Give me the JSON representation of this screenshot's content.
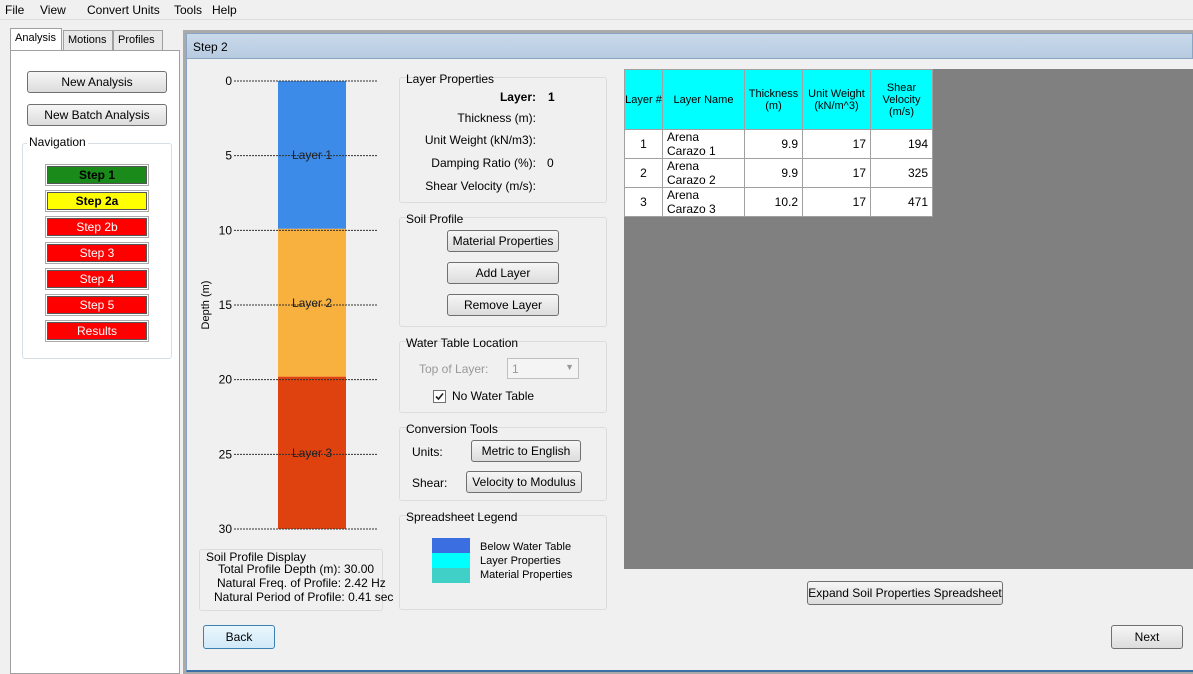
{
  "menu": [
    "File",
    "View",
    "Convert Units",
    "Tools",
    "Help"
  ],
  "tabs": [
    "Analysis",
    "Motions",
    "Profiles"
  ],
  "left": {
    "new_analysis": "New Analysis",
    "new_batch": "New Batch Analysis",
    "navigation_label": "Navigation",
    "steps": [
      {
        "label": "Step 1",
        "color": "#1a8a1a",
        "text_color": "#000000"
      },
      {
        "label": "Step 2a",
        "color": "#ffff00",
        "text_color": "#000000"
      },
      {
        "label": "Step 2b",
        "color": "#ff0000",
        "text_color": "#ffffff"
      },
      {
        "label": "Step 3",
        "color": "#ff0000",
        "text_color": "#ffffff"
      },
      {
        "label": "Step 4",
        "color": "#ff0000",
        "text_color": "#ffffff"
      },
      {
        "label": "Step 5",
        "color": "#ff0000",
        "text_color": "#ffffff"
      },
      {
        "label": "Results",
        "color": "#ff0000",
        "text_color": "#ffffff"
      }
    ]
  },
  "title": "Step 2",
  "profile": {
    "ylabel": "Depth (m)",
    "ticks": [
      "0",
      "5",
      "10",
      "15",
      "20",
      "25",
      "30"
    ],
    "layers": [
      {
        "label": "Layer 1",
        "from": 0,
        "to": 9.9,
        "color": "#3d8be8"
      },
      {
        "label": "Layer 2",
        "from": 9.9,
        "to": 19.8,
        "color": "#f8b13f"
      },
      {
        "label": "Layer 3",
        "from": 19.8,
        "to": 30,
        "color": "#e0420f"
      }
    ],
    "display_label": "Soil Profile Display",
    "total_depth": "Total Profile Depth (m): 30.00",
    "nat_freq": "Natural Freq. of Profile: 2.42 Hz",
    "nat_period": "Natural Period of Profile: 0.41 sec"
  },
  "layer_props": {
    "title": "Layer Properties",
    "layer_label": "Layer:",
    "layer_value": "1",
    "thickness": "Thickness (m):",
    "unit_weight": "Unit Weight (kN/m3):",
    "damping": "Damping Ratio (%):",
    "damping_value": "0",
    "shear": "Shear Velocity (m/s):"
  },
  "soil_profile": {
    "title": "Soil Profile",
    "material": "Material Properties",
    "add": "Add Layer",
    "remove": "Remove Layer"
  },
  "water": {
    "title": "Water Table Location",
    "top_label": "Top of Layer:",
    "top_value": "1",
    "no_water": "No Water Table"
  },
  "conversion": {
    "title": "Conversion Tools",
    "units_label": "Units:",
    "units_btn": "Metric to English",
    "shear_label": "Shear:",
    "shear_btn": "Velocity to Modulus"
  },
  "legend": {
    "title": "Spreadsheet Legend",
    "items": [
      {
        "label": "Below Water Table",
        "color": "#3b6ee0"
      },
      {
        "label": "Layer Properties",
        "color": "#00ffff"
      },
      {
        "label": "Material Properties",
        "color": "#40d0c8"
      }
    ]
  },
  "table": {
    "headers": [
      "Layer #",
      "Layer Name",
      "Thickness (m)",
      "Unit Weight (kN/m^3)",
      "Shear Velocity (m/s)"
    ],
    "rows": [
      [
        "1",
        "Arena Carazo 1",
        "9.9",
        "17",
        "194"
      ],
      [
        "2",
        "Arena Carazo 2",
        "9.9",
        "17",
        "325"
      ],
      [
        "3",
        "Arena Carazo 3",
        "10.2",
        "17",
        "471"
      ]
    ]
  },
  "expand_btn": "Expand Soil Properties Spreadsheet",
  "back_btn": "Back",
  "next_btn": "Next"
}
